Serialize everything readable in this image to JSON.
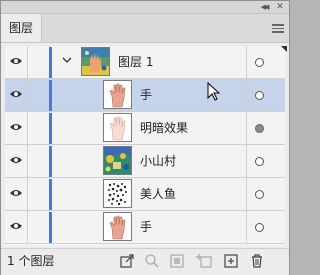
{
  "panel": {
    "tab_label": "图层",
    "collapse_glyph": "◀◀",
    "close_glyph": "✕"
  },
  "layers": [
    {
      "name": "图层 1",
      "type": "group",
      "selected": false,
      "target": "hollow",
      "thumb": "gradient-art"
    },
    {
      "name": "手",
      "type": "sublayer",
      "selected": true,
      "target": "hollow",
      "thumb": "hand"
    },
    {
      "name": "明暗效果",
      "type": "sublayer",
      "selected": false,
      "target": "filled",
      "thumb": "hand-light"
    },
    {
      "name": "小山村",
      "type": "sublayer",
      "selected": false,
      "target": "hollow",
      "thumb": "village"
    },
    {
      "name": "美人鱼",
      "type": "sublayer",
      "selected": false,
      "target": "hollow",
      "thumb": "dots"
    },
    {
      "name": "手",
      "type": "sublayer",
      "selected": false,
      "target": "hollow",
      "thumb": "hand"
    }
  ],
  "footer": {
    "layer_count": "1 个图层"
  },
  "colors": {
    "selection": "#c5d4ea",
    "layer_color_bar": "#4e77d6",
    "panel_bg": "#ececec"
  },
  "icons": [
    "eye-icon",
    "chevron-down-icon",
    "target-icon",
    "export-icon",
    "search-icon",
    "clipping-mask-icon",
    "new-sublayer-icon",
    "new-layer-icon",
    "trash-icon"
  ]
}
